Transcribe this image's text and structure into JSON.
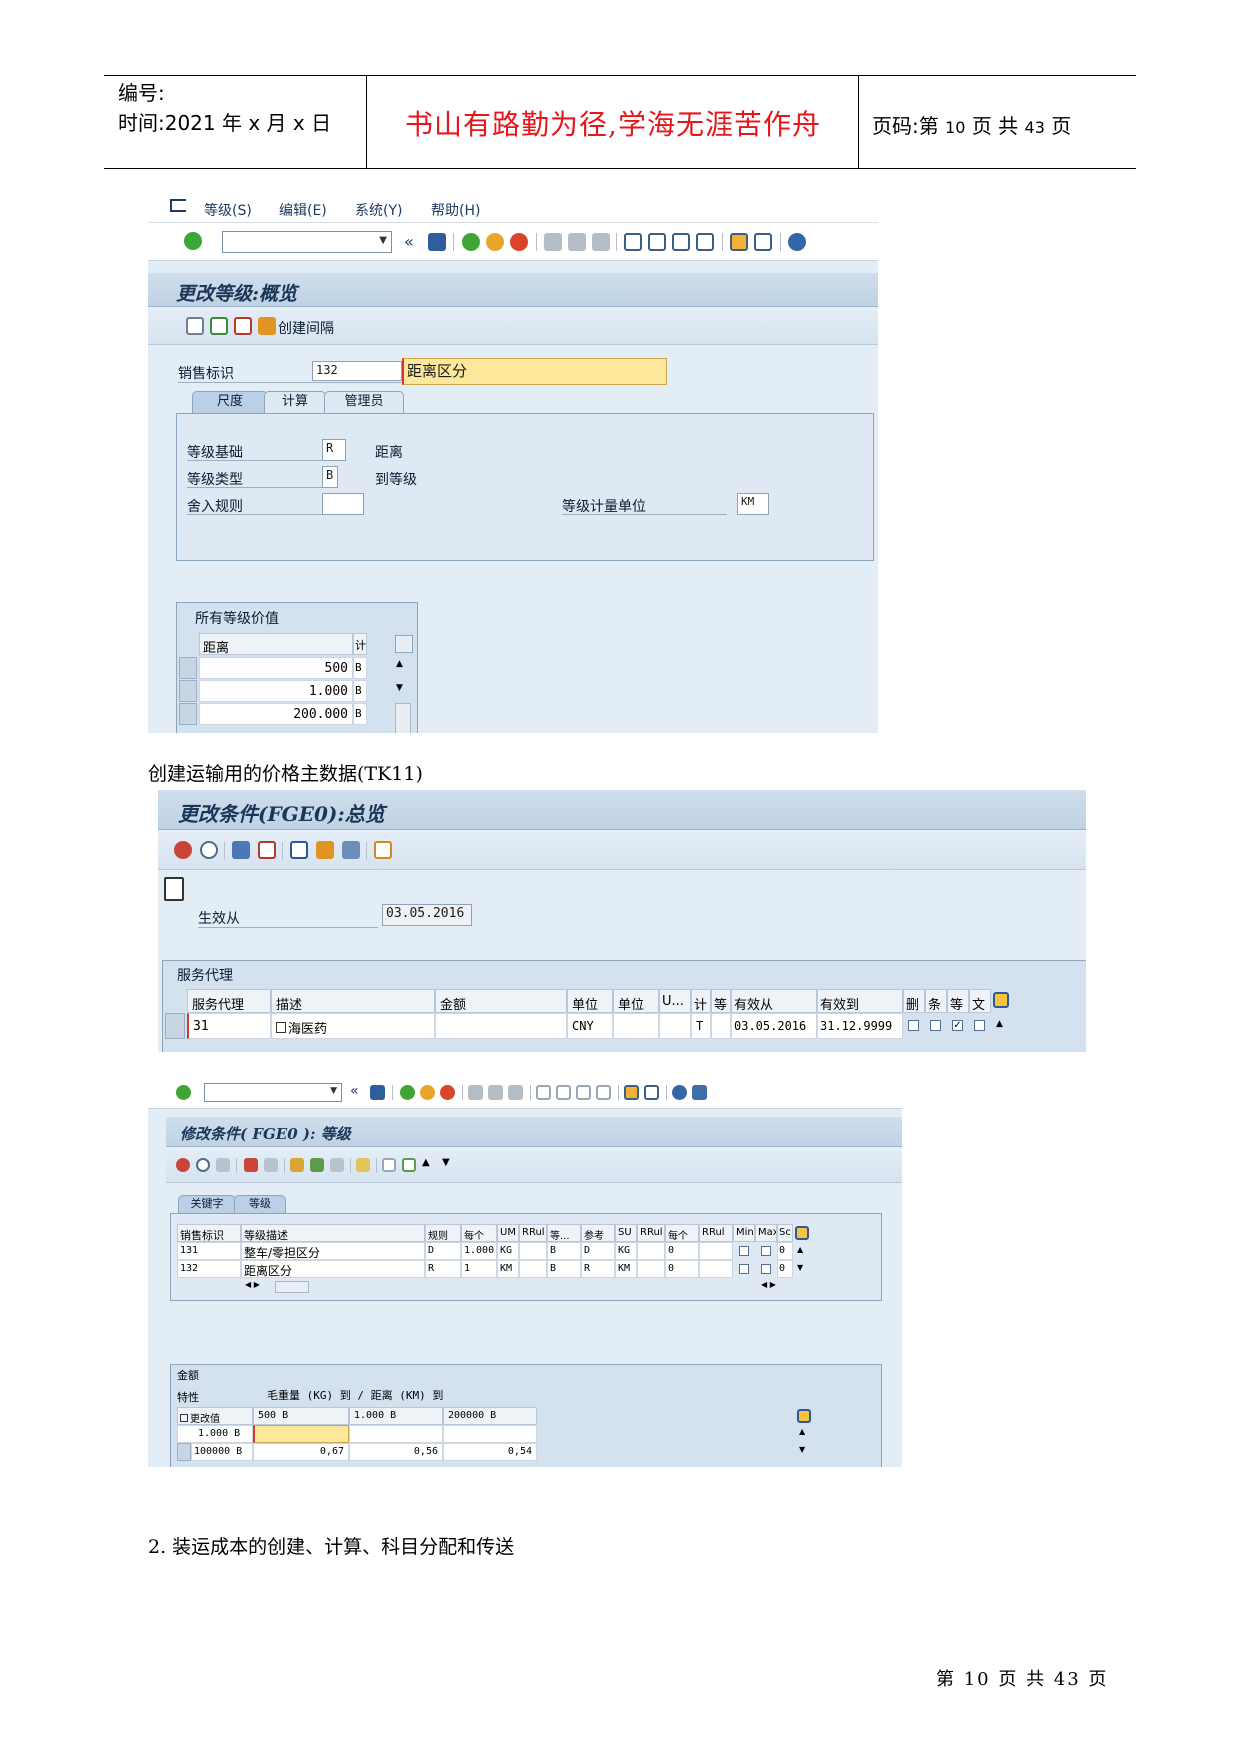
{
  "header": {
    "number_label": "编号:",
    "time_label": "时间:2021 年 x 月 x 日",
    "motto": "书山有路勤为径,学海无涯苦作舟",
    "page_prefix": "页码:第 ",
    "page_current": "10",
    "page_mid": " 页  共 ",
    "page_total": "43",
    "page_suffix": " 页"
  },
  "screen1": {
    "menu": [
      "等级(S)",
      "编辑(E)",
      "系统(Y)",
      "帮助(H)"
    ],
    "title": "更改等级:概览",
    "create_interval": "创建间隔",
    "sales_id_label": "销售标识",
    "sales_id_value": "132",
    "sales_id_desc": "距离区分",
    "tabs": [
      "尺度",
      "计算",
      "管理员"
    ],
    "scale_base_label": "等级基础",
    "scale_base_value": "R",
    "scale_base_desc": "距离",
    "scale_type_label": "等级类型",
    "scale_type_value": "B",
    "scale_type_desc": "到等级",
    "rounding_label": "舍入规则",
    "rounding_value": "",
    "unit_label": "等级计量单位",
    "unit_value": "KM",
    "values_group": "所有等级价值",
    "col_distance": "距离",
    "col_unit": "计",
    "rows": [
      {
        "value": "500",
        "unit": "B"
      },
      {
        "value": "1.000",
        "unit": "B"
      },
      {
        "value": "200.000",
        "unit": "B"
      }
    ]
  },
  "caption1": "创建运输用的价格主数据(TK11)",
  "screen2": {
    "title": "更改条件(FGE0):总览",
    "valid_from_label": "生效从",
    "valid_from_value": "03.05.2016",
    "group_title": "服务代理",
    "columns": [
      "服务代理",
      "描述",
      "金额",
      "单位",
      "单位",
      "U...",
      "计",
      "等",
      "有效从",
      "有效到",
      "删",
      "条",
      "等",
      "文"
    ],
    "row": {
      "agent": "31",
      "desc": "海医药",
      "amount": "",
      "currency": "CNY",
      "unit": "",
      "u": "",
      "calc": "T",
      "scale": "",
      "valid_from": "03.05.2016",
      "valid_to": "31.12.9999",
      "checks": [
        false,
        false,
        true,
        false
      ]
    }
  },
  "screen3": {
    "title": "修改条件( FGE0 ): 等级",
    "tabs": [
      "关键字",
      "等级"
    ],
    "columns": [
      "销售标识",
      "等级描述",
      "规则",
      "每个",
      "UM",
      "RRul",
      "等...",
      "参考",
      "SU",
      "RRul",
      "每个",
      "RRul",
      "Min",
      "Max",
      "Sc"
    ],
    "rows": [
      {
        "id": "131",
        "desc": "整车/零担区分",
        "rule": "D",
        "per": "1.000",
        "um": "KG",
        "rrul": "",
        "scale": "B",
        "ref": "D",
        "su": "KG",
        "rrul2": "",
        "per2": "0",
        "rrul3": "",
        "min": false,
        "max": false,
        "sc": "0"
      },
      {
        "id": "132",
        "desc": "距离区分",
        "rule": "R",
        "per": "1",
        "um": "KM",
        "rrul": "",
        "scale": "B",
        "ref": "R",
        "su": "KM",
        "rrul2": "",
        "per2": "0",
        "rrul3": "",
        "min": false,
        "max": false,
        "sc": "0"
      }
    ],
    "amount_group": "金额",
    "feature_label": "特性",
    "feature_text": "毛重量 (KG) 到 / 距离 (KM) 到",
    "change_value": "更改值",
    "col_heads": [
      "500  B",
      "1.000  B",
      "200000  B"
    ],
    "grid_rows": [
      {
        "label": "1.000  B",
        "values": [
          "",
          "",
          ""
        ]
      },
      {
        "label": "100000  B",
        "values": [
          "0,67",
          "0,56",
          "0,54"
        ]
      }
    ]
  },
  "caption2": "2. 装运成本的创建、计算、科目分配和传送",
  "footer": "第 10 页 共 43 页"
}
